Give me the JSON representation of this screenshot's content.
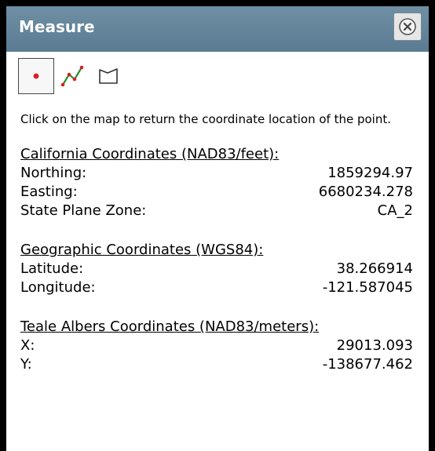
{
  "panel": {
    "title": "Measure",
    "close_icon": "close-circle-icon"
  },
  "tools": [
    {
      "name": "point-tool",
      "icon": "point-icon",
      "selected": true
    },
    {
      "name": "line-tool",
      "icon": "polyline-icon",
      "selected": false
    },
    {
      "name": "area-tool",
      "icon": "polygon-icon",
      "selected": false
    }
  ],
  "colors": {
    "header": "#6a89a0",
    "point_red": "#d9202a",
    "line_green": "#2e8b2e"
  },
  "instructions": "Click on the map to return the coordinate location of the point.",
  "california": {
    "title": "California Coordinates (NAD83/feet):",
    "rows": [
      {
        "label": "Northing:",
        "value": "1859294.97"
      },
      {
        "label": "Easting:",
        "value": "6680234.278"
      },
      {
        "label": "State Plane Zone:",
        "value": "CA_2"
      }
    ]
  },
  "geographic": {
    "title": "Geographic Coordinates (WGS84):",
    "rows": [
      {
        "label": "Latitude:",
        "value": "38.266914"
      },
      {
        "label": "Longitude:",
        "value": "-121.587045"
      }
    ]
  },
  "teale": {
    "title": "Teale Albers Coordinates (NAD83/meters):",
    "rows": [
      {
        "label": "X:",
        "value": "29013.093"
      },
      {
        "label": "Y:",
        "value": "-138677.462"
      }
    ]
  }
}
